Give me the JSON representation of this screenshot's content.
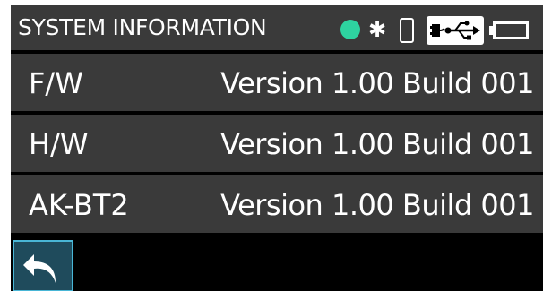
{
  "header": {
    "title": "SYSTEM INFORMATION",
    "status_dot_color": "#2ed3a0",
    "icons": [
      "status-dot",
      "bluetooth-icon",
      "phone-icon",
      "usb-icon",
      "battery-icon"
    ],
    "bluetooth_glyph": "✱"
  },
  "rows": [
    {
      "label": "F/W",
      "value": "Version 1.00 Build 001"
    },
    {
      "label": "H/W",
      "value": "Version 1.00 Build 001"
    },
    {
      "label": "AK-BT2",
      "value": "Version 1.00 Build 001"
    }
  ],
  "footer": {
    "back_icon": "back-arrow-icon",
    "back_button_color": "#1f4b5c",
    "back_button_border": "#49b6d6"
  }
}
